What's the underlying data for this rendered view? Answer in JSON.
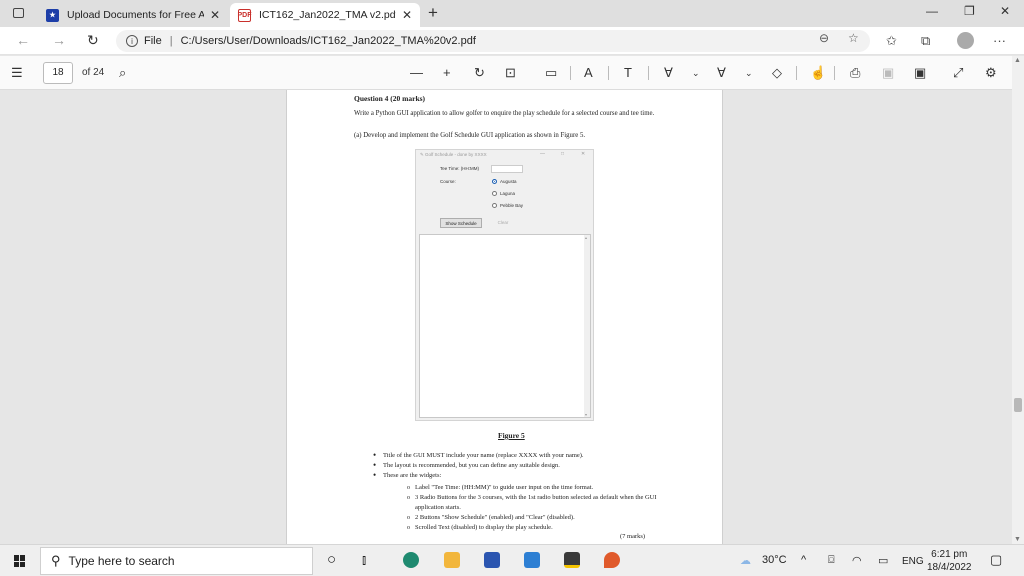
{
  "browser": {
    "tabs": [
      {
        "title": "Upload Documents for Free Acce",
        "favicon": "star-icon"
      },
      {
        "title": "ICT162_Jan2022_TMA v2.pdf",
        "favicon": "pdf-icon"
      }
    ],
    "address": {
      "scheme": "File",
      "url": "C:/Users/User/Downloads/ICT162_Jan2022_TMA%20v2.pdf"
    }
  },
  "pdf_toolbar": {
    "page_number": "18",
    "page_total": "of 24"
  },
  "document": {
    "question_title": "Question 4 (20 marks)",
    "question_text": "Write a Python GUI application to allow golfer to enquire the play schedule for a selected course and tee time.",
    "part_a": "(a)  Develop and implement the Golf Schedule GUI application as shown in Figure 5.",
    "figure": {
      "window_title": "Golf Schedule - done by XXXX",
      "tee_label": "Tee Time: (HH:MM)",
      "course_label": "Course:",
      "radios": [
        "Augusta",
        "Laguna",
        "Pebble Bay"
      ],
      "show_button": "Show Schedule",
      "clear_button": "Clear"
    },
    "figure_caption": "Figure 5",
    "bullets": [
      "Title of the GUI MUST include your name (replace XXXX with your name).",
      "The layout is recommended, but you can define any suitable design.",
      "These are the widgets:"
    ],
    "sub_bullets": [
      "Label \"Tee Time: (HH:MM)\" to guide user input on the time format.",
      "3 Radio Buttons for the 3 courses, with the 1st radio button selected as default when the GUI application starts.",
      "2 Buttons \"Show Schedule\" (enabled) and \"Clear\" (disabled).",
      "Scrolled Text (disabled) to display the play schedule."
    ],
    "marks": "(7 marks)"
  },
  "taskbar": {
    "search_placeholder": "Type here to search",
    "weather": "30°C",
    "language": "ENG",
    "time": "6:21 pm",
    "date": "18/4/2022"
  }
}
